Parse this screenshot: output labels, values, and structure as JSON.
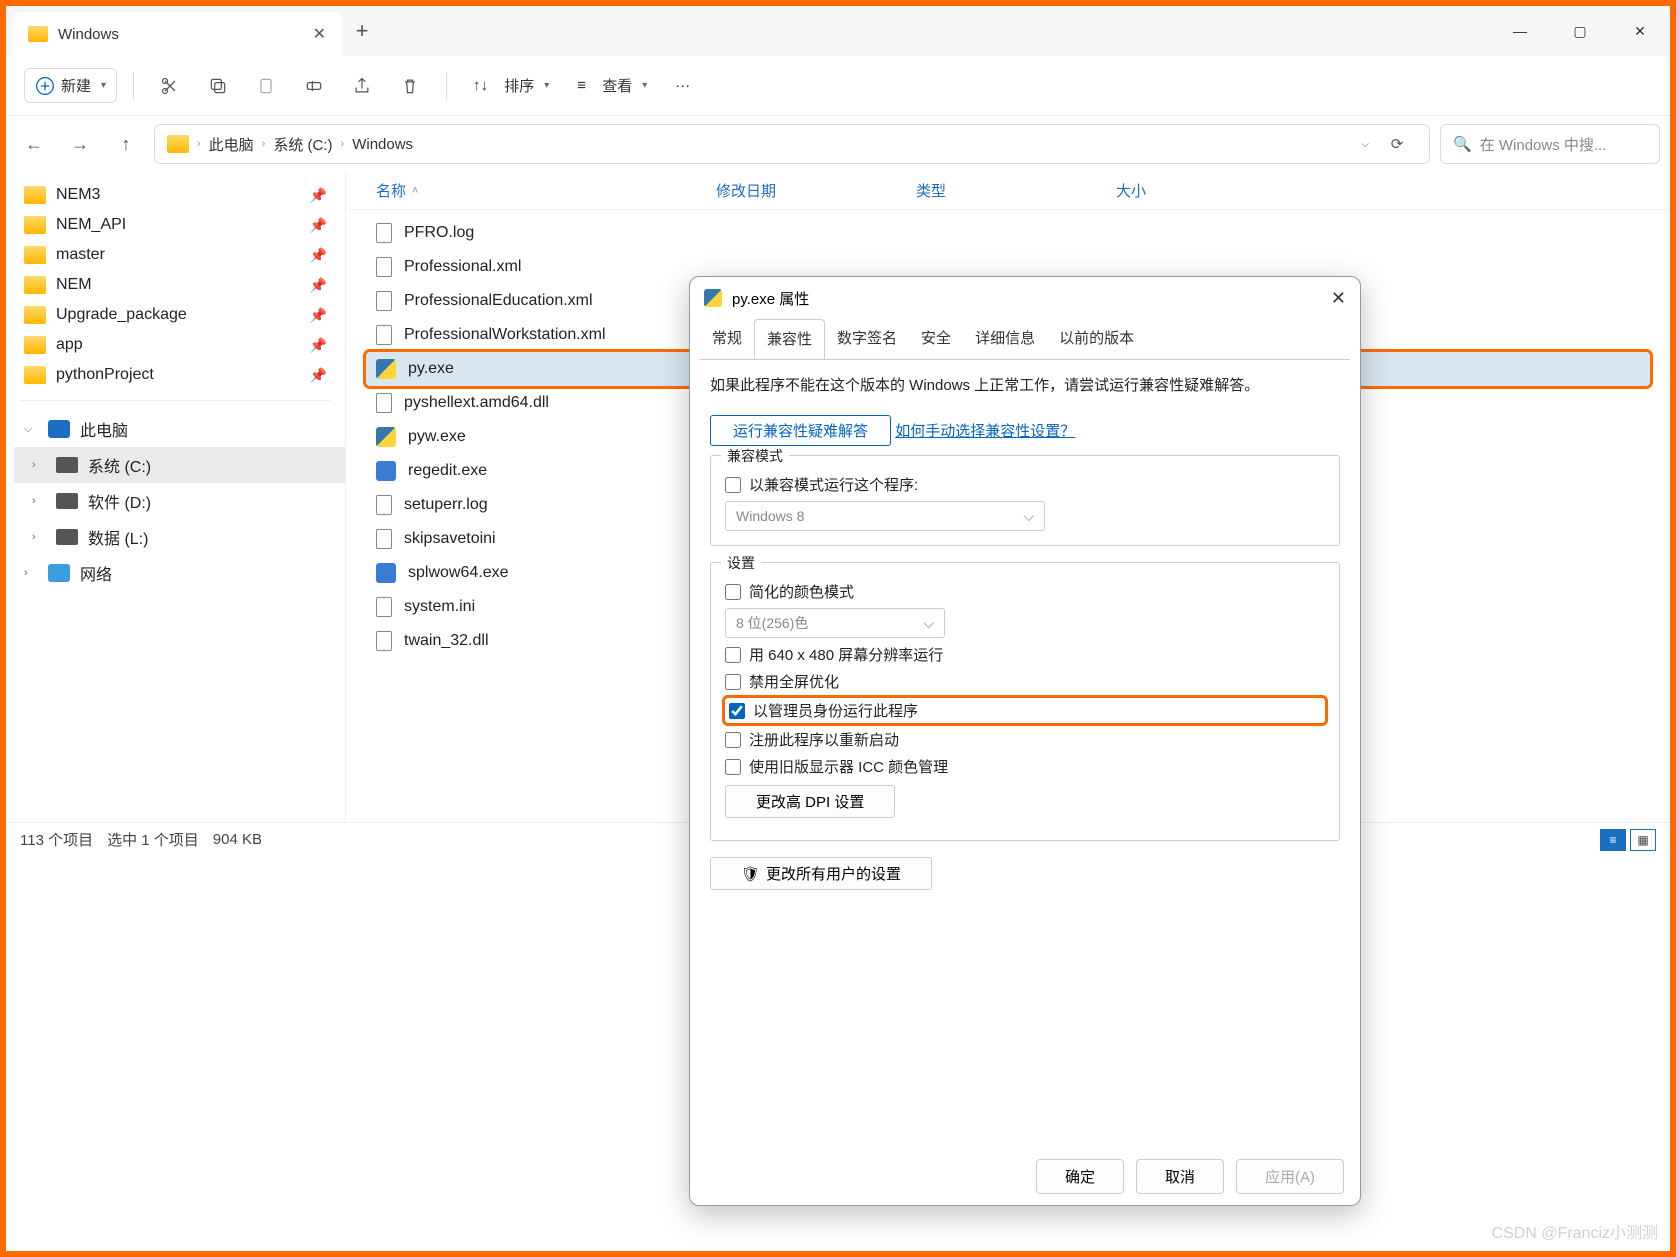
{
  "tab": {
    "title": "Windows"
  },
  "toolbar": {
    "new": "新建",
    "sort": "排序",
    "view": "查看"
  },
  "breadcrumb": {
    "p1": "此电脑",
    "p2": "系统 (C:)",
    "p3": "Windows"
  },
  "search": {
    "placeholder": "在 Windows 中搜..."
  },
  "sidebar": {
    "quick": [
      {
        "label": "NEM3"
      },
      {
        "label": "NEM_API"
      },
      {
        "label": "master"
      },
      {
        "label": "NEM"
      },
      {
        "label": "Upgrade_package"
      },
      {
        "label": "app"
      },
      {
        "label": "pythonProject"
      }
    ],
    "pc": "此电脑",
    "drives": [
      {
        "label": "系统 (C:)"
      },
      {
        "label": "软件 (D:)"
      },
      {
        "label": "数据 (L:)"
      }
    ],
    "network": "网络"
  },
  "columns": {
    "name": "名称",
    "modified": "修改日期",
    "type": "类型",
    "size": "大小"
  },
  "files": [
    {
      "name": "PFRO.log",
      "kind": "doc"
    },
    {
      "name": "Professional.xml",
      "kind": "doc"
    },
    {
      "name": "ProfessionalEducation.xml",
      "kind": "doc"
    },
    {
      "name": "ProfessionalWorkstation.xml",
      "kind": "doc"
    },
    {
      "name": "py.exe",
      "kind": "py",
      "selected": true,
      "highlight": true
    },
    {
      "name": "pyshellext.amd64.dll",
      "kind": "doc"
    },
    {
      "name": "pyw.exe",
      "kind": "py"
    },
    {
      "name": "regedit.exe",
      "kind": "app"
    },
    {
      "name": "setuperr.log",
      "kind": "doc"
    },
    {
      "name": "skipsavetoini",
      "kind": "doc"
    },
    {
      "name": "splwow64.exe",
      "kind": "app"
    },
    {
      "name": "system.ini",
      "kind": "doc"
    },
    {
      "name": "twain_32.dll",
      "kind": "doc"
    }
  ],
  "status": {
    "count": "113 个项目",
    "sel": "选中 1 个项目",
    "size": "904 KB"
  },
  "props": {
    "title": "py.exe 属性",
    "tabs": {
      "general": "常规",
      "compat": "兼容性",
      "sig": "数字签名",
      "sec": "安全",
      "detail": "详细信息",
      "prev": "以前的版本"
    },
    "intro": "如果此程序不能在这个版本的 Windows 上正常工作，请尝试运行兼容性疑难解答。",
    "troubleshoot": "运行兼容性疑难解答",
    "manual_link": "如何手动选择兼容性设置？",
    "compat_group": "兼容模式",
    "compat_chk": "以兼容模式运行这个程序:",
    "compat_combo": "Windows 8",
    "settings_group": "设置",
    "reduced_color": "简化的颜色模式",
    "color_combo": "8 位(256)色",
    "res640": "用 640 x 480 屏幕分辨率运行",
    "disable_fs": "禁用全屏优化",
    "run_admin": "以管理员身份运行此程序",
    "reg_restart": "注册此程序以重新启动",
    "legacy_icc": "使用旧版显示器 ICC 颜色管理",
    "dpi_btn": "更改高 DPI 设置",
    "all_users_btn": "更改所有用户的设置",
    "ok": "确定",
    "cancel": "取消",
    "apply": "应用(A)"
  },
  "watermark": "CSDN @Franciz小测测"
}
